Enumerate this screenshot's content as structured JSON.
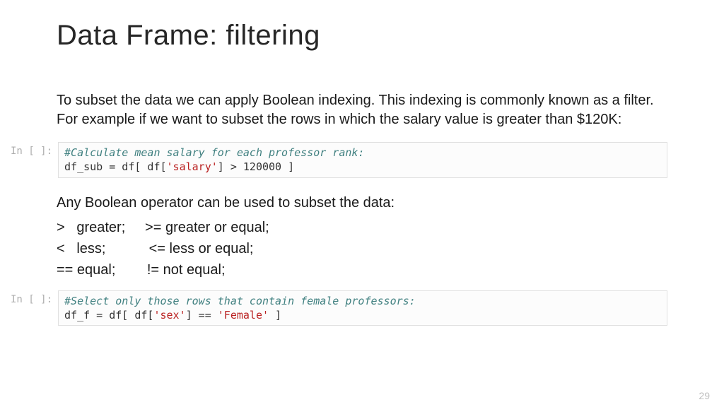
{
  "title": "Data Frame: filtering",
  "intro": "To subset the data we can apply Boolean indexing. This indexing is commonly known as a filter.  For example if we want to subset the rows in which the salary value is greater than $120K:",
  "prompt1": "In [ ]:",
  "code1": {
    "comment": "#Calculate mean salary for each professor rank:",
    "pre": "df_sub = df[ df[",
    "str": "'salary'",
    "post": "] > 120000 ]"
  },
  "mid": "Any Boolean operator can be used to subset the data:",
  "ops": {
    "l1": ">   greater;     >= greater or equal;",
    "l2": "<   less;           <= less or equal;",
    "l3": "== equal;        != not equal;"
  },
  "prompt2": "In [ ]:",
  "code2": {
    "comment": "#Select only those rows that contain female professors:",
    "pre": "df_f = df[ df[",
    "str1": "'sex'",
    "mid": "] == ",
    "str2": "'Female'",
    "post": " ]"
  },
  "page": "29"
}
